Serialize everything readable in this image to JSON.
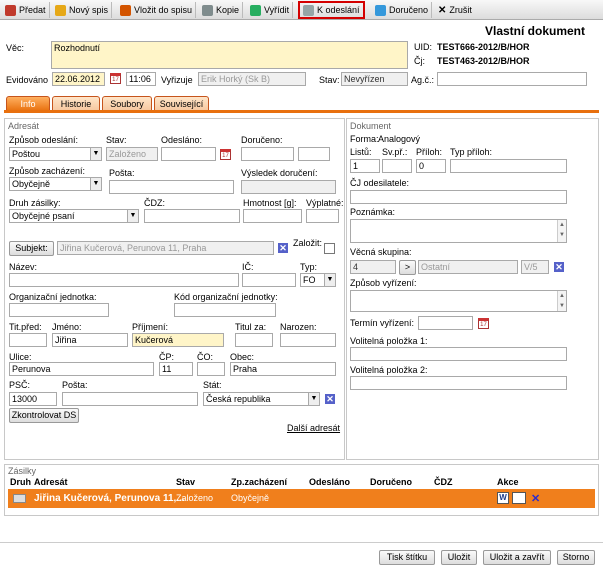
{
  "toolbar": {
    "items": [
      {
        "label": "Předat",
        "color": "#c0392b"
      },
      {
        "label": "Nový spis",
        "color": "#e6a817"
      },
      {
        "label": "Vložit do spisu",
        "color": "#d35400"
      },
      {
        "label": "Kopie",
        "color": "#7f8c8d"
      },
      {
        "label": "Vyřídit",
        "color": "#27ae60"
      },
      {
        "label": "K odeslání",
        "color": "#95a5a6"
      },
      {
        "label": "Doručeno",
        "color": "#3498db"
      },
      {
        "label": "Zrušit",
        "color": "#222222"
      }
    ]
  },
  "page_title": "Vlastní dokument",
  "header": {
    "vec_label": "Věc:",
    "vec_value": "Rozhodnutí",
    "uid_label": "UID:",
    "uid_value": "TEST666-2012/B/HOR",
    "cj_label": "Čj:",
    "cj_value": "TEST463-2012/B/HOR",
    "evidovano_label": "Evidováno",
    "evidovano_date": "22.06.2012",
    "evidovano_time": "11:06",
    "vyrizuje_label": "Vyřizuje",
    "vyrizuje_value": "Erik Horký (Sk B)",
    "stav_label": "Stav:",
    "stav_value": "Nevyřízen",
    "agc_label": "Ag.č.:",
    "agc_value": ""
  },
  "tabs": [
    "Info",
    "Historie",
    "Soubory",
    "Související"
  ],
  "adresat": {
    "section": "Adresát",
    "zpusob_odeslani_label": "Způsob odeslání:",
    "zpusob_odeslani_value": "Poštou",
    "stav_label": "Stav:",
    "stav_value": "Založeno",
    "odeslano_label": "Odesláno:",
    "doruceno_label": "Doručeno:",
    "zpusob_zachazeni_label": "Způsob zacházení:",
    "zpusob_zachazeni_value": "Obyčejně",
    "posta_label": "Pošta:",
    "vysledek_label": "Výsledek doručení:",
    "druh_zasilky_label": "Druh zásilky:",
    "druh_zasilky_value": "Obyčejné psaní",
    "cdz_label": "ČDZ:",
    "hmotnost_label": "Hmotnost [g]:",
    "vyplatne_label": "Výplatné:",
    "subjekt_button": "Subjekt:",
    "subjekt_value": "Jiřina Kučerová, Perunova 11, Praha",
    "zalozit_label": "Založit:",
    "nazev_label": "Název:",
    "ic_label": "IČ:",
    "typ_label": "Typ:",
    "typ_value": "FO",
    "org_jednotka_label": "Organizační jednotka:",
    "kod_org_label": "Kód organizační jednotky:",
    "titpred_label": "Tit.před:",
    "jmeno_label": "Jméno:",
    "jmeno_value": "Jiřina",
    "prijmeni_label": "Příjmení:",
    "prijmeni_value": "Kučerová",
    "titza_label": "Titul za:",
    "narozen_label": "Narozen:",
    "ulice_label": "Ulice:",
    "ulice_value": "Perunova",
    "cp_label": "ČP:",
    "cp_value": "11",
    "co_label": "ČO:",
    "obec_label": "Obec:",
    "obec_value": "Praha",
    "psc_label": "PSČ:",
    "psc_value": "13000",
    "posta2_label": "Pošta:",
    "stat_label": "Stát:",
    "stat_value": "Česká republika",
    "zkontrolovat_button": "Zkontrolovat DS",
    "dalsi_adresat_link": "Další adresát"
  },
  "dokument": {
    "section": "Dokument",
    "forma_label": "Forma:",
    "forma_value": "Analogový",
    "listu_label": "Listů:",
    "listu_value": "1",
    "svpr_label": "Sv.př.:",
    "priloh_label": "Příloh:",
    "priloh_value": "0",
    "typ_priloh_label": "Typ příloh:",
    "cj_odesilatele_label": "ČJ odesilatele:",
    "poznamka_label": "Poznámka:",
    "vecna_skupina_label": "Věcná skupina:",
    "vecna_skupina_code": "4",
    "vecna_skupina_arrow": ">",
    "vecna_skupina_value": "Ostatní",
    "vecna_skupina_suffix": "V/5",
    "zpusob_vyrizeni_label": "Způsob vyřízení:",
    "termin_label": "Termín vyřízení:",
    "volitelna1_label": "Volitelná položka 1:",
    "volitelna2_label": "Volitelná položka 2:"
  },
  "zasilky": {
    "section": "Zásilky",
    "columns": [
      "Druh",
      "Adresát",
      "Stav",
      "Zp.zacházení",
      "Odesláno",
      "Doručeno",
      "ČDZ",
      "Akce"
    ],
    "row": {
      "adresat": "Jiřina Kučerová, Perunova 11,...",
      "stav": "Založeno",
      "zachazeni": "Obyčejně",
      "odeslano": "",
      "doruceno": "",
      "cdz": ""
    }
  },
  "footer": {
    "buttons": [
      "Tisk štítku",
      "Uložit",
      "Uložit a zavřít",
      "Storno"
    ]
  },
  "colors": {
    "accent": "#e8700e",
    "highlight": "#d40000",
    "row_bg": "#f07f1c"
  }
}
